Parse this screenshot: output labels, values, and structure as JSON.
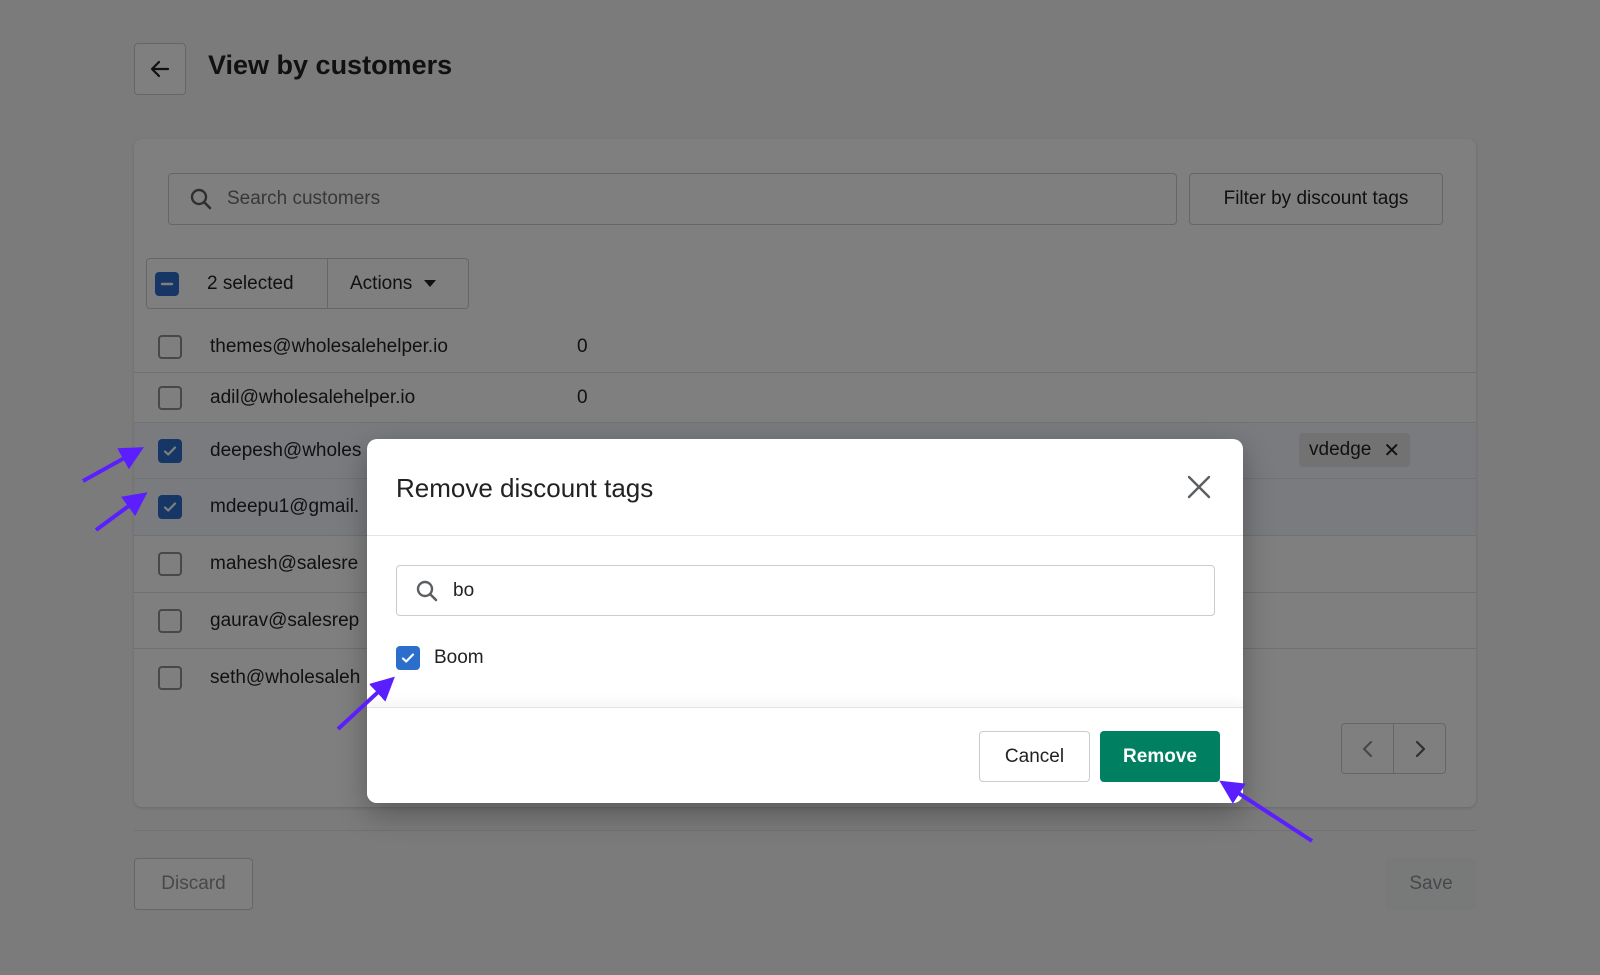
{
  "header": {
    "title": "View by customers"
  },
  "search": {
    "placeholder": "Search customers"
  },
  "filter": {
    "label": "Filter by discount tags"
  },
  "bulk": {
    "selected_text": "2 selected",
    "actions_label": "Actions"
  },
  "rows": [
    {
      "email": "themes@wholesalehelper.io",
      "count": "0",
      "checked": false
    },
    {
      "email": "adil@wholesalehelper.io",
      "count": "0",
      "checked": false
    },
    {
      "email": "deepesh@wholes",
      "count": "",
      "checked": true,
      "tags": [
        "vdedge"
      ]
    },
    {
      "email": "mdeepu1@gmail.",
      "count": "",
      "checked": true
    },
    {
      "email": "mahesh@salesre",
      "count": "",
      "checked": false
    },
    {
      "email": "gaurav@salesrep",
      "count": "",
      "checked": false
    },
    {
      "email": "seth@wholesaleh",
      "count": "",
      "checked": false
    }
  ],
  "footer": {
    "discard_label": "Discard",
    "save_label": "Save"
  },
  "modal": {
    "title": "Remove discount tags",
    "search_value": "bo",
    "options": [
      {
        "label": "Boom",
        "checked": true
      }
    ],
    "cancel_label": "Cancel",
    "remove_label": "Remove"
  },
  "colors": {
    "primary_green": "#008060",
    "checkbox_blue": "#2c6ecb",
    "annotation_arrow": "#5b1fff"
  }
}
